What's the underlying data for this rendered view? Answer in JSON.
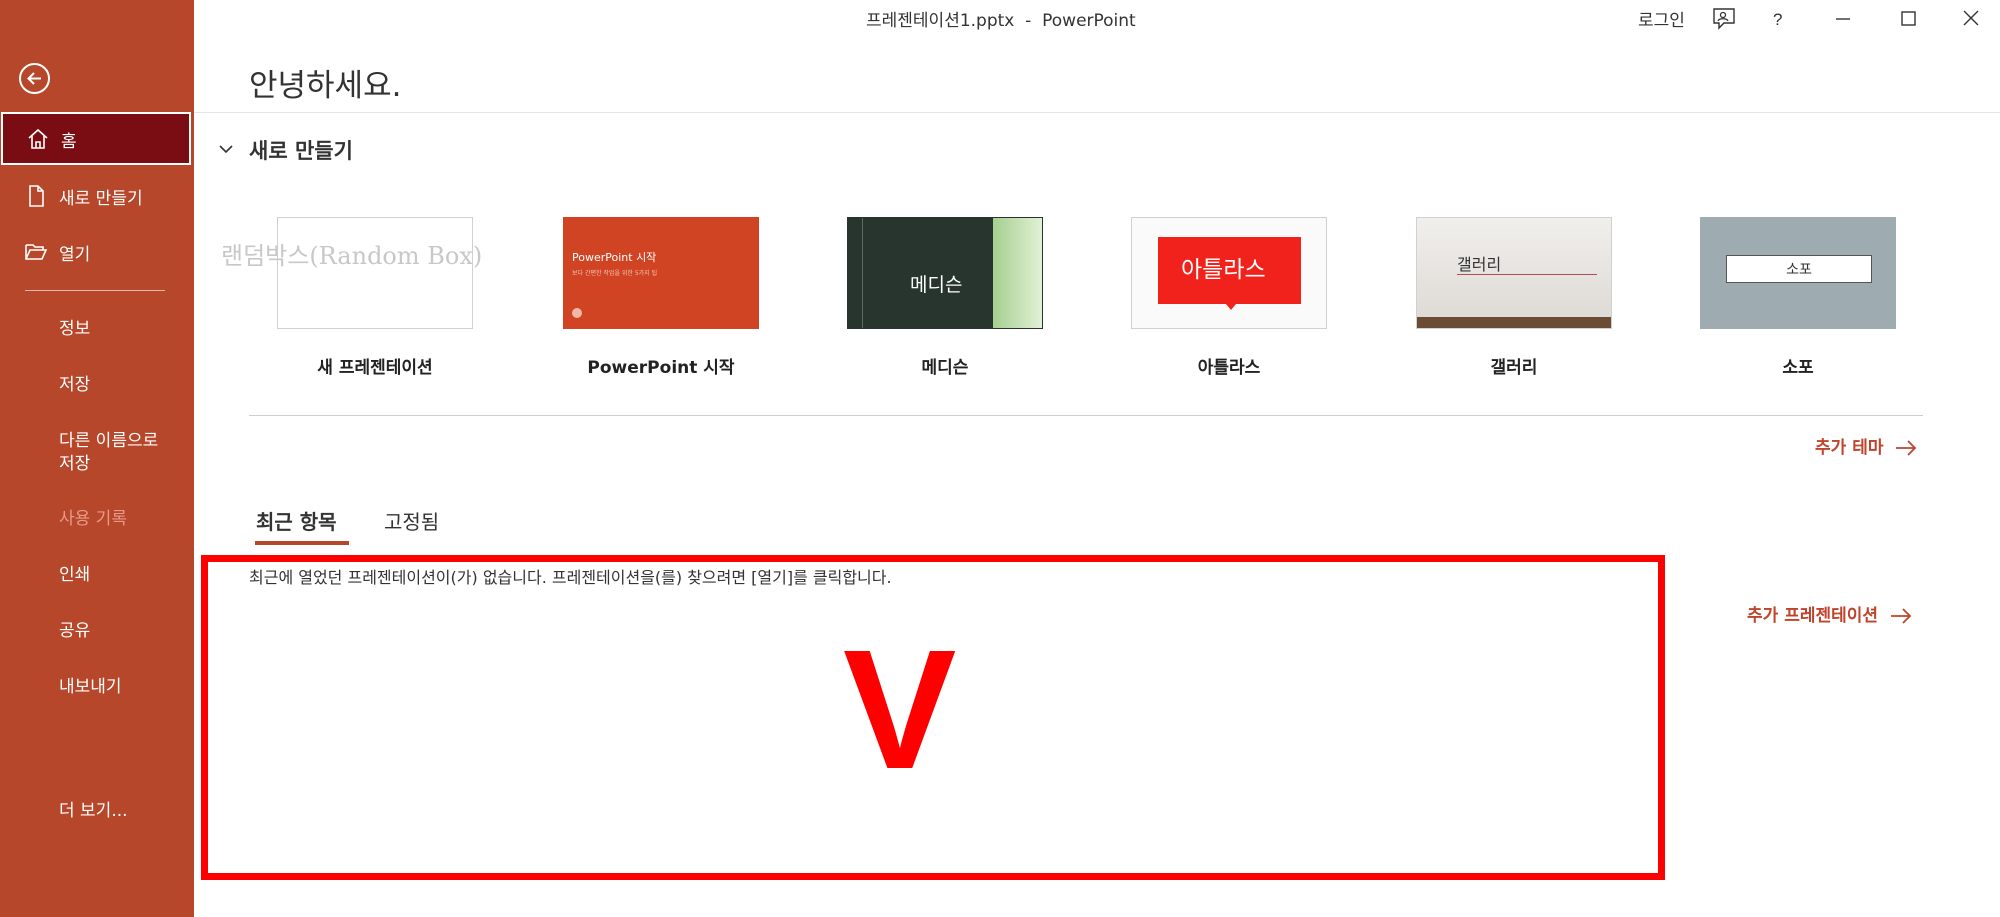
{
  "window": {
    "title": "프레젠테이션1.pptx  -  PowerPoint",
    "login_label": "로그인"
  },
  "sidebar": {
    "back": "back-arrow-icon",
    "items": [
      {
        "label": "홈",
        "icon": "home-icon",
        "active": true
      },
      {
        "label": "새로 만들기",
        "icon": "new-document-icon"
      },
      {
        "label": "열기",
        "icon": "folder-open-icon"
      }
    ],
    "secondary": [
      {
        "label": "정보"
      },
      {
        "label": "저장"
      },
      {
        "label": "다른 이름으로\n저장"
      },
      {
        "label": "사용 기록",
        "disabled": true
      },
      {
        "label": "인쇄"
      },
      {
        "label": "공유"
      },
      {
        "label": "내보내기"
      },
      {
        "label": "더 보기..."
      }
    ]
  },
  "main": {
    "greeting": "안녕하세요.",
    "new_section_title": "새로 만들기",
    "templates": [
      {
        "name": "새 프레젠테이션"
      },
      {
        "name": "PowerPoint 시작",
        "thumb_title": "PowerPoint 시작",
        "thumb_sub": "보다 간편한 작업을 위한 5가지 팁"
      },
      {
        "name": "메디슨",
        "thumb_title": "메디슨"
      },
      {
        "name": "아틀라스",
        "thumb_title": "아틀라스"
      },
      {
        "name": "갤러리",
        "thumb_title": "갤러리"
      },
      {
        "name": "소포",
        "thumb_title": "소포"
      }
    ],
    "more_themes": "추가 테마",
    "tabs": [
      {
        "label": "최근 항목",
        "active": true
      },
      {
        "label": "고정됨"
      }
    ],
    "empty_message": "최근에 열었던 프레젠테이션이(가) 없습니다. 프레젠테이션을(를) 찾으려면 [열기]를 클릭합니다.",
    "more_presentations": "추가 프레젠테이션"
  },
  "overlay": {
    "watermark": "랜덤박스(Random Box)",
    "mark": "V",
    "color": "#ff0000"
  },
  "colors": {
    "sidebar": "#b7472a",
    "active_item": "#7a0d14",
    "link": "#c0442b"
  }
}
